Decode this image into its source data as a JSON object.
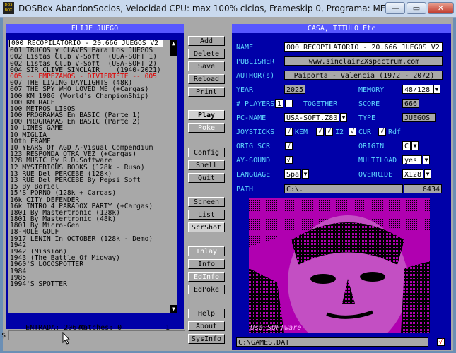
{
  "window": {
    "title": "DOSBox AbandonSocios, Velocidad CPU: max 100% ciclos, Frameskip  0, Programa:     MENU",
    "icon_text": "DOS BOX",
    "min_glyph": "—",
    "max_glyph": "▭",
    "close_glyph": "✕"
  },
  "left_panel": {
    "title": "ELIJE JUEGO",
    "items": [
      "000 RECOPILATORIO - 20.666 JUEGOS V2",
      "001 TRUCOS y CLAVES Para Los JUEGOS",
      "002 Listas Club V-Soft  (USA-SOFT 1)",
      "002 Listas Club V-Soft  (USA-SOFT 2)",
      "004 SIR CLIVE SINCLAIR    (1940-2021)",
      "005 -- EMPEZAMOS - DIVIERTETE -- 005",
      "007 THE LIVING DAYLIGHTS (48k)",
      "007 THE SPY WHO LOVED ME (+Cargas)",
      "100 KM 1986 (World's ChampionShip)",
      "100 KM RACE",
      "100 METROS LISOS",
      "100 PROGRAMAS En BASIC (Parte 1)",
      "100 PROGRAMAS En BASIC (Parte 2)",
      "10 LINES GAME",
      "10 MIGLIA",
      "10th FRAME",
      "10 YEARS Of AGD A-Visual Compendium",
      "123 RESPONDA OTRA VEZ (+Cargas)",
      "128 MUSIC By R.D.Software",
      "12 MYSTERIOUS BOOKS (128k - Ruso)",
      "13 RUE Del PERCEBE (128k)",
      "13 RUE Del PERCEBE By Pepsi Soft",
      "15 By Boriel",
      "15'S PORNO (128k + Cargas)",
      "16k CITY DEFENDER",
      "16k INTRO 4 PARADOX PARTY (+Cargas)",
      "1801 By Mastertronic (128k)",
      "1801 By Mastertronic (48k)",
      "1801 By Micro-Gen",
      "18-HOLE GOLF",
      "1917 LENIN In OCTOBER (128k - Demo)",
      "1942",
      "1942 (Mission)",
      "1943 (The Battle Of Midway)",
      "1960'S LOCOSPOTTER",
      "1984",
      "1985",
      "1994'S SPOTTER"
    ],
    "selected_index": 0,
    "highlight_index": 5,
    "entrada_label": "ENTRADA: 20670",
    "matches_label": "Matches: 0",
    "page_number": "1",
    "scroll_up": "▲",
    "scroll_down": "▼",
    "bottom_prefix": "$"
  },
  "buttons": {
    "add": "Add",
    "delete": "Delete",
    "save": "Save",
    "reload": "Reload",
    "print": "Print",
    "play": "Play",
    "poke": "Poke",
    "config": "Config",
    "shell": "Shell",
    "quit": "Quit",
    "screen": "Screen",
    "list": "List",
    "scrshot": "ScrShot",
    "inlay": "Inlay",
    "info": "Info",
    "edinfo": "EdInfo",
    "edpoke": "EdPoke",
    "help": "Help",
    "about": "About",
    "sysinfo": "SysInfo"
  },
  "right_panel": {
    "title": "CASA, TITULO Etc",
    "name_label": "NAME",
    "name_value": "000 RECOPILATORIO - 20.666 JUEGOS V2",
    "publisher_label": "PUBLISHER",
    "publisher_value": "www.sinclairZXspectrum.com",
    "author_label": "AUTHOR(s)",
    "author_value": "Paiporta - Valencia  (1972 - 2072)",
    "year_label": "YEAR",
    "year_value": "2025",
    "memory_label": "MEMORY",
    "memory_value": "48/128",
    "players_label": "# PLAYERS",
    "players_value": "1",
    "together_label": "TOGETHER",
    "score_label": "SCORE",
    "score_value": "666",
    "pcname_label": "PC-NAME",
    "pcname_value": "USA-SOFT.Z80",
    "type_label": "TYPE",
    "type_value": "JUEGOS",
    "joysticks_label": "JOYSTICKS",
    "kem_label": "KEM",
    "i2_label": "I2",
    "cur_label": "CUR",
    "rdf_label": "Rdf",
    "check_mark": "√",
    "origscr_label": "ORIG SCR",
    "origin_label": "ORIGIN",
    "origin_value": "C",
    "aysound_label": "AY-SOUND",
    "multiload_label": "MULTILOAD",
    "multiload_value": "yes",
    "language_label": "LANGUAGE",
    "language_value": "Spa",
    "override_label": "OVERRIDE",
    "override_value": "X128",
    "path_label": "PATH",
    "path_value": "C:\\.",
    "path_number": "6434",
    "screenshot_caption": "Usa-SOFTware",
    "dat_path": "C:\\GAMES.DAT",
    "dat_check": "√",
    "drop_glyph": "▼"
  },
  "colors": {
    "panel_blue": "#0000a8",
    "title_blue": "#5757ff",
    "label_cyan": "#5fd7ff",
    "highlight_red": "#e00000",
    "screenshot_magenta": "#b000b0"
  }
}
